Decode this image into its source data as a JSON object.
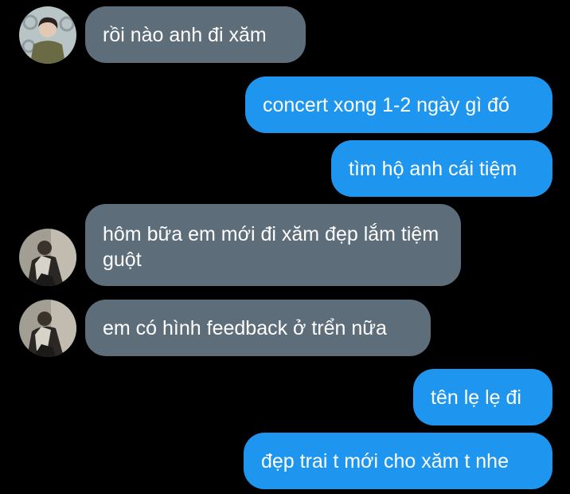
{
  "messages": [
    {
      "direction": "incoming",
      "text": "rồi nào anh đi xăm",
      "avatar": "avatar-1"
    },
    {
      "direction": "outgoing",
      "text": "concert xong 1-2 ngày gì đó"
    },
    {
      "direction": "outgoing",
      "text": "tìm hộ anh cái tiệm"
    },
    {
      "direction": "incoming",
      "text": "hôm bữa em mới đi xăm đẹp lắm tiệm guột",
      "avatar": "avatar-2"
    },
    {
      "direction": "incoming",
      "text": "em có hình feedback ở trển nữa",
      "avatar": "avatar-2"
    },
    {
      "direction": "outgoing",
      "text": "tên lẹ lẹ đi"
    },
    {
      "direction": "outgoing",
      "text": "đẹp trai t mới cho xăm t nhe"
    }
  ],
  "colors": {
    "background": "#000000",
    "incoming_bubble": "#5e6d7a",
    "outgoing_bubble": "#1e96ef",
    "text": "#ffffff"
  }
}
